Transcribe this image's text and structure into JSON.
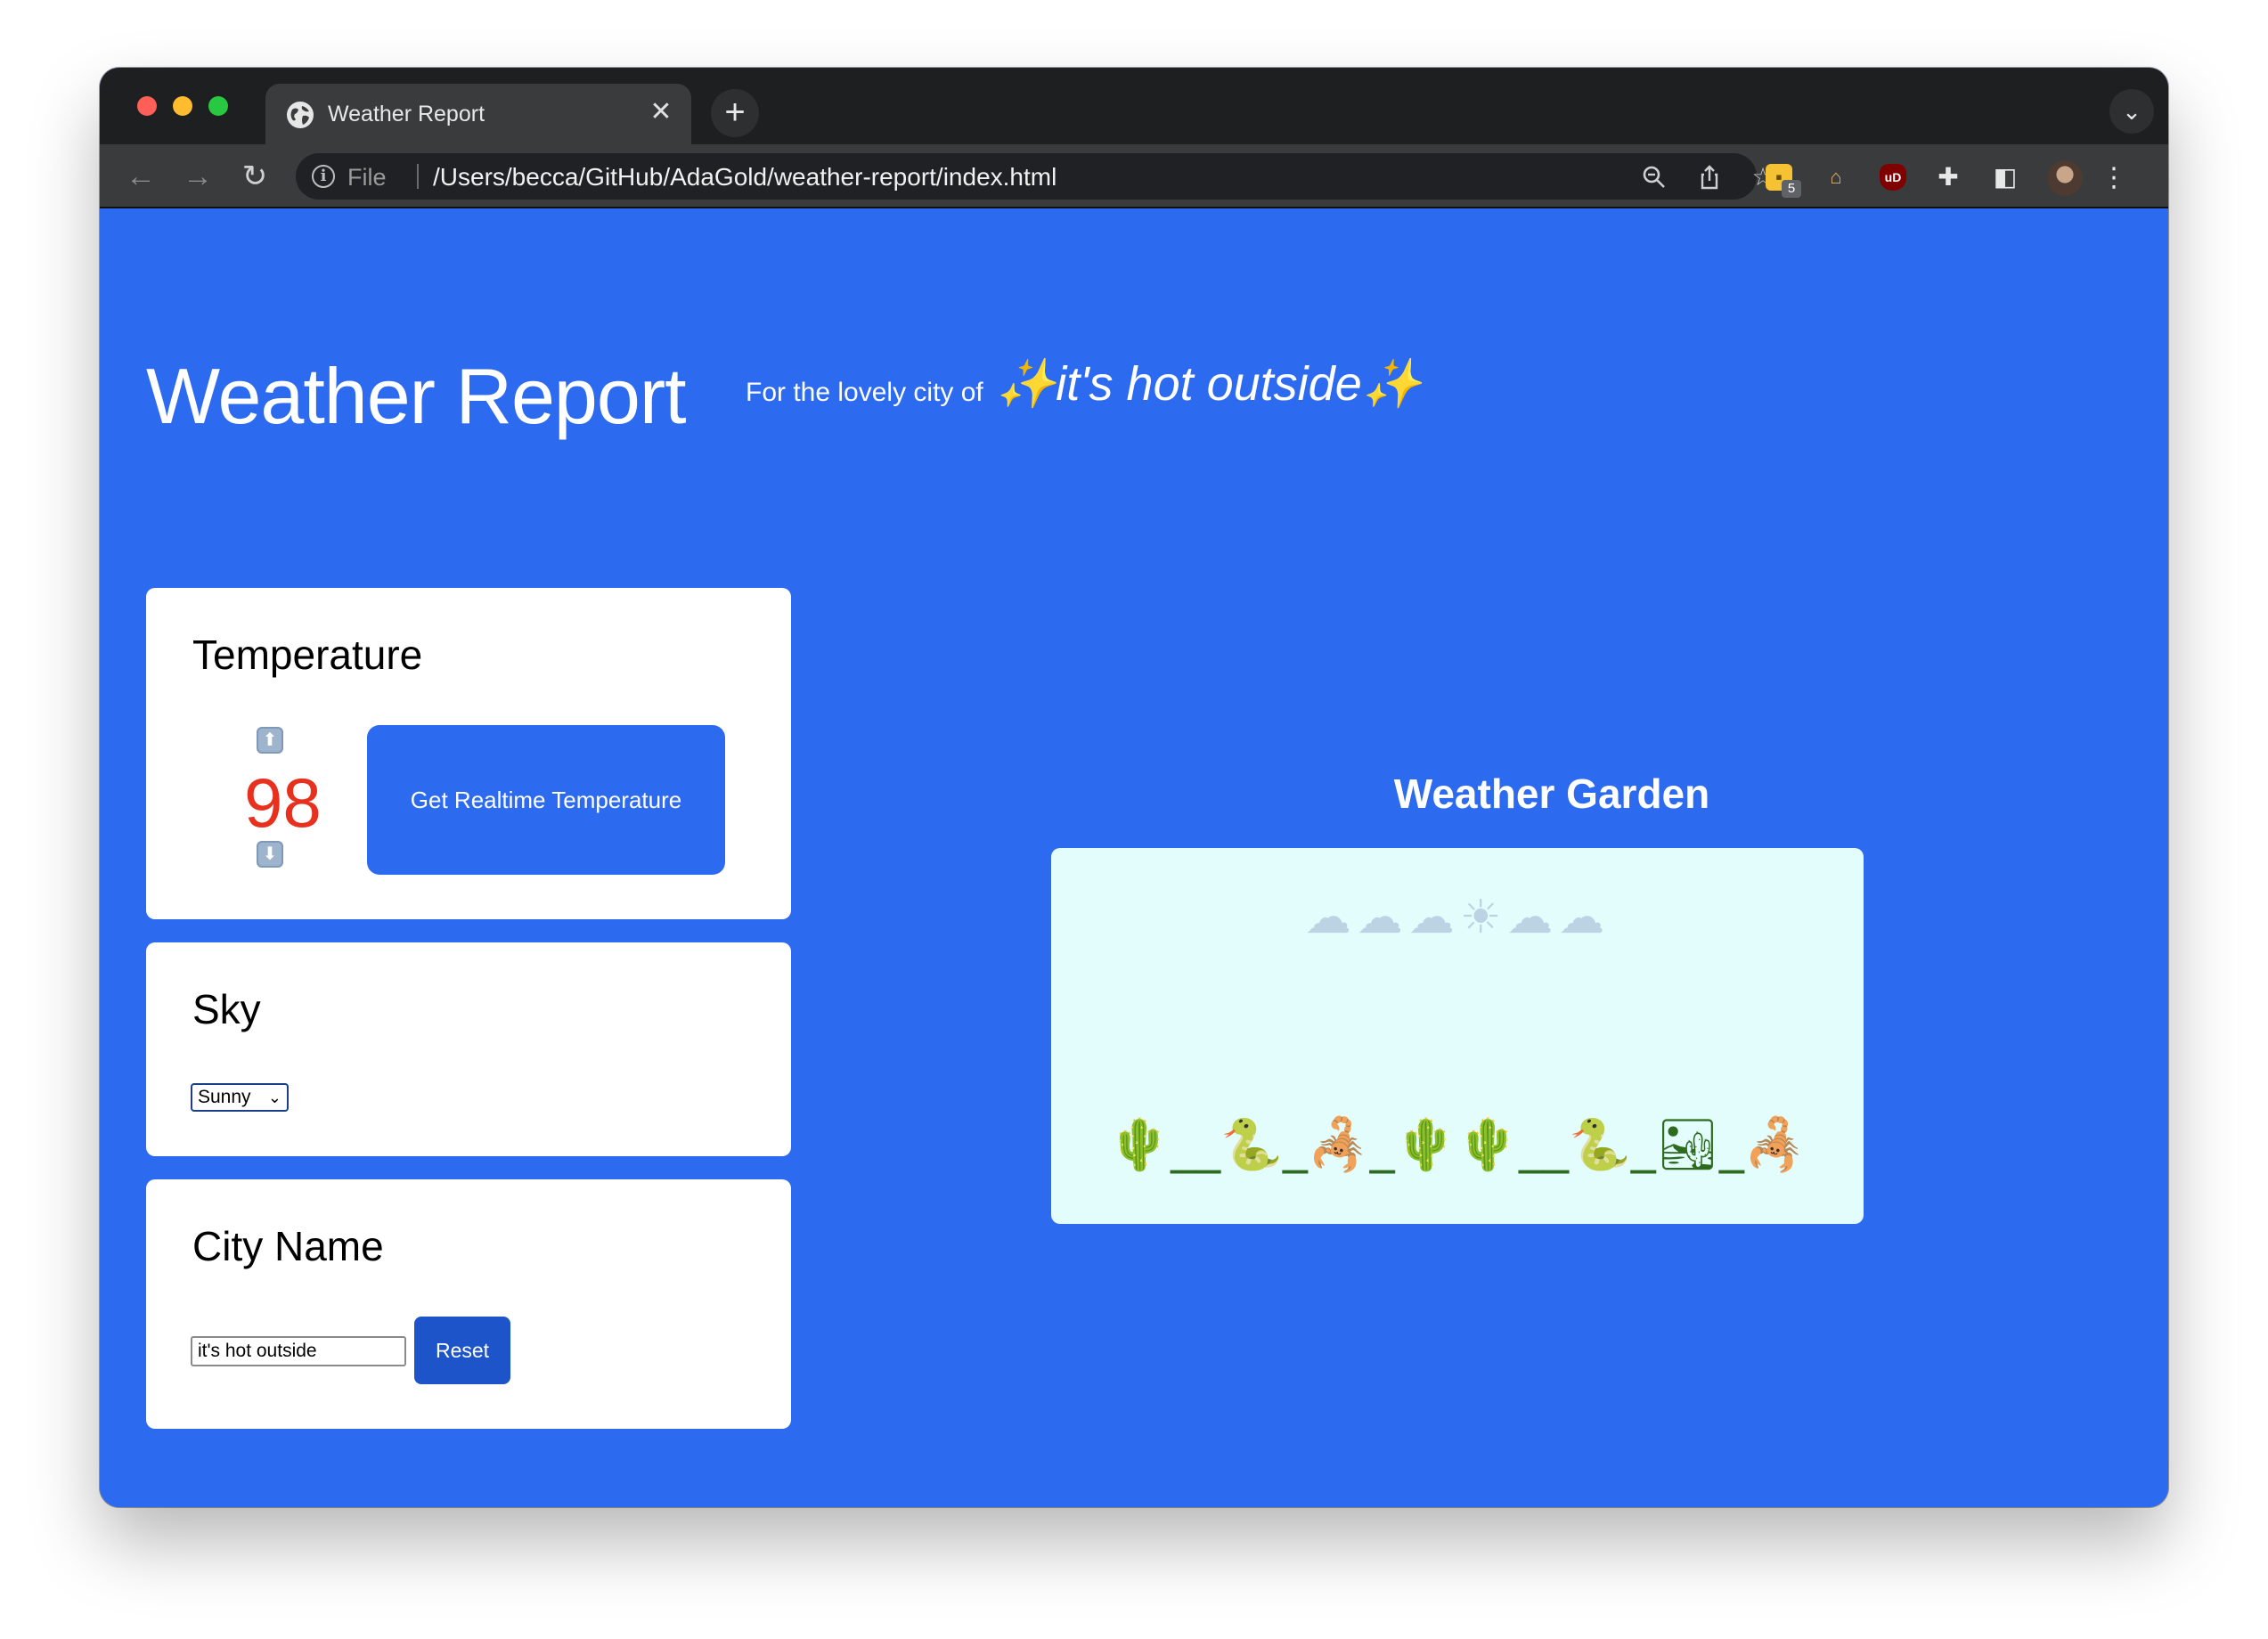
{
  "browser": {
    "tab_title": "Weather Report",
    "tab_close": "✕",
    "new_tab": "+",
    "tab_menu": "⌄",
    "scheme_label": "File",
    "url": "/Users/becca/GitHub/AdaGold/weather-report/index.html",
    "extension_badge_count": "5",
    "ublock_label": "uD",
    "icons": [
      "back-icon",
      "forward-icon",
      "reload-icon",
      "info-icon",
      "zoom-icon",
      "share-icon",
      "star-icon",
      "extensions-icon",
      "profile-avatar",
      "menu-icon"
    ]
  },
  "header": {
    "title": "Weather Report",
    "tagline_prefix": "For the lovely city of",
    "city_display": "✨it's hot outside✨"
  },
  "temperature": {
    "heading": "Temperature",
    "value": "98",
    "value_color": "#e8301e",
    "up_arrow": "⬆",
    "down_arrow": "⬇",
    "realtime_button": "Get Realtime Temperature"
  },
  "sky": {
    "heading": "Sky",
    "selected": "Sunny"
  },
  "city": {
    "heading": "City Name",
    "input_value": "it's hot outside",
    "reset_button": "Reset"
  },
  "garden": {
    "title": "Weather Garden",
    "sky_row": "☁☁☁☀☁☁",
    "landscape_row": "🌵__🐍_🦂_🌵🌵__🐍_🏜_🦂"
  },
  "colors": {
    "page_background": "#2c6af0",
    "card_background": "#ffffff",
    "garden_background": "#e3fdfd",
    "reset_button": "#1d54c9"
  }
}
